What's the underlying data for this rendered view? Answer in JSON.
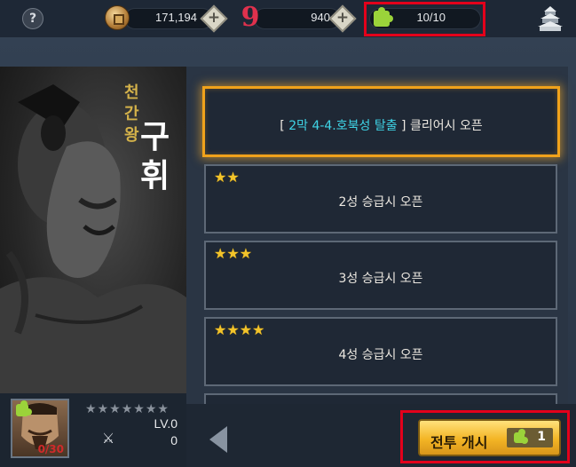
{
  "topbar": {
    "help_label": "?",
    "gold": "171,194",
    "gems": "940",
    "puzzle_energy": "10/10",
    "plus_label": "+"
  },
  "hero": {
    "title_small": [
      "천",
      "간",
      "왕"
    ],
    "title_big": [
      "구",
      "휘"
    ],
    "level": "LV.0",
    "power": "0",
    "shard_count": "0/30",
    "star_slots": 7,
    "star_filled": 0
  },
  "stages": [
    {
      "prefix": "[ ",
      "link": "2막 4-4.호북성 탈출",
      "suffix": " ] 클리어시 오픈",
      "stars": 0,
      "highlighted": true
    },
    {
      "text": "2성 승급시 오픈",
      "stars": 2
    },
    {
      "text": "3성 승급시 오픈",
      "stars": 3
    },
    {
      "text": "4성 승급시 오픈",
      "stars": 4
    }
  ],
  "battle": {
    "label": "전투 개시",
    "cost": "1"
  },
  "colors": {
    "accent_gold": "#f0a21b",
    "link_cyan": "#3fd4e6",
    "energy_green": "#9bd33a",
    "highlight_red": "#e3001b"
  },
  "icons": [
    "help-icon",
    "gold-coin-icon",
    "gem-icon",
    "puzzle-piece-icon",
    "castle-icon",
    "swords-icon",
    "back-arrow-icon",
    "star-icon"
  ]
}
